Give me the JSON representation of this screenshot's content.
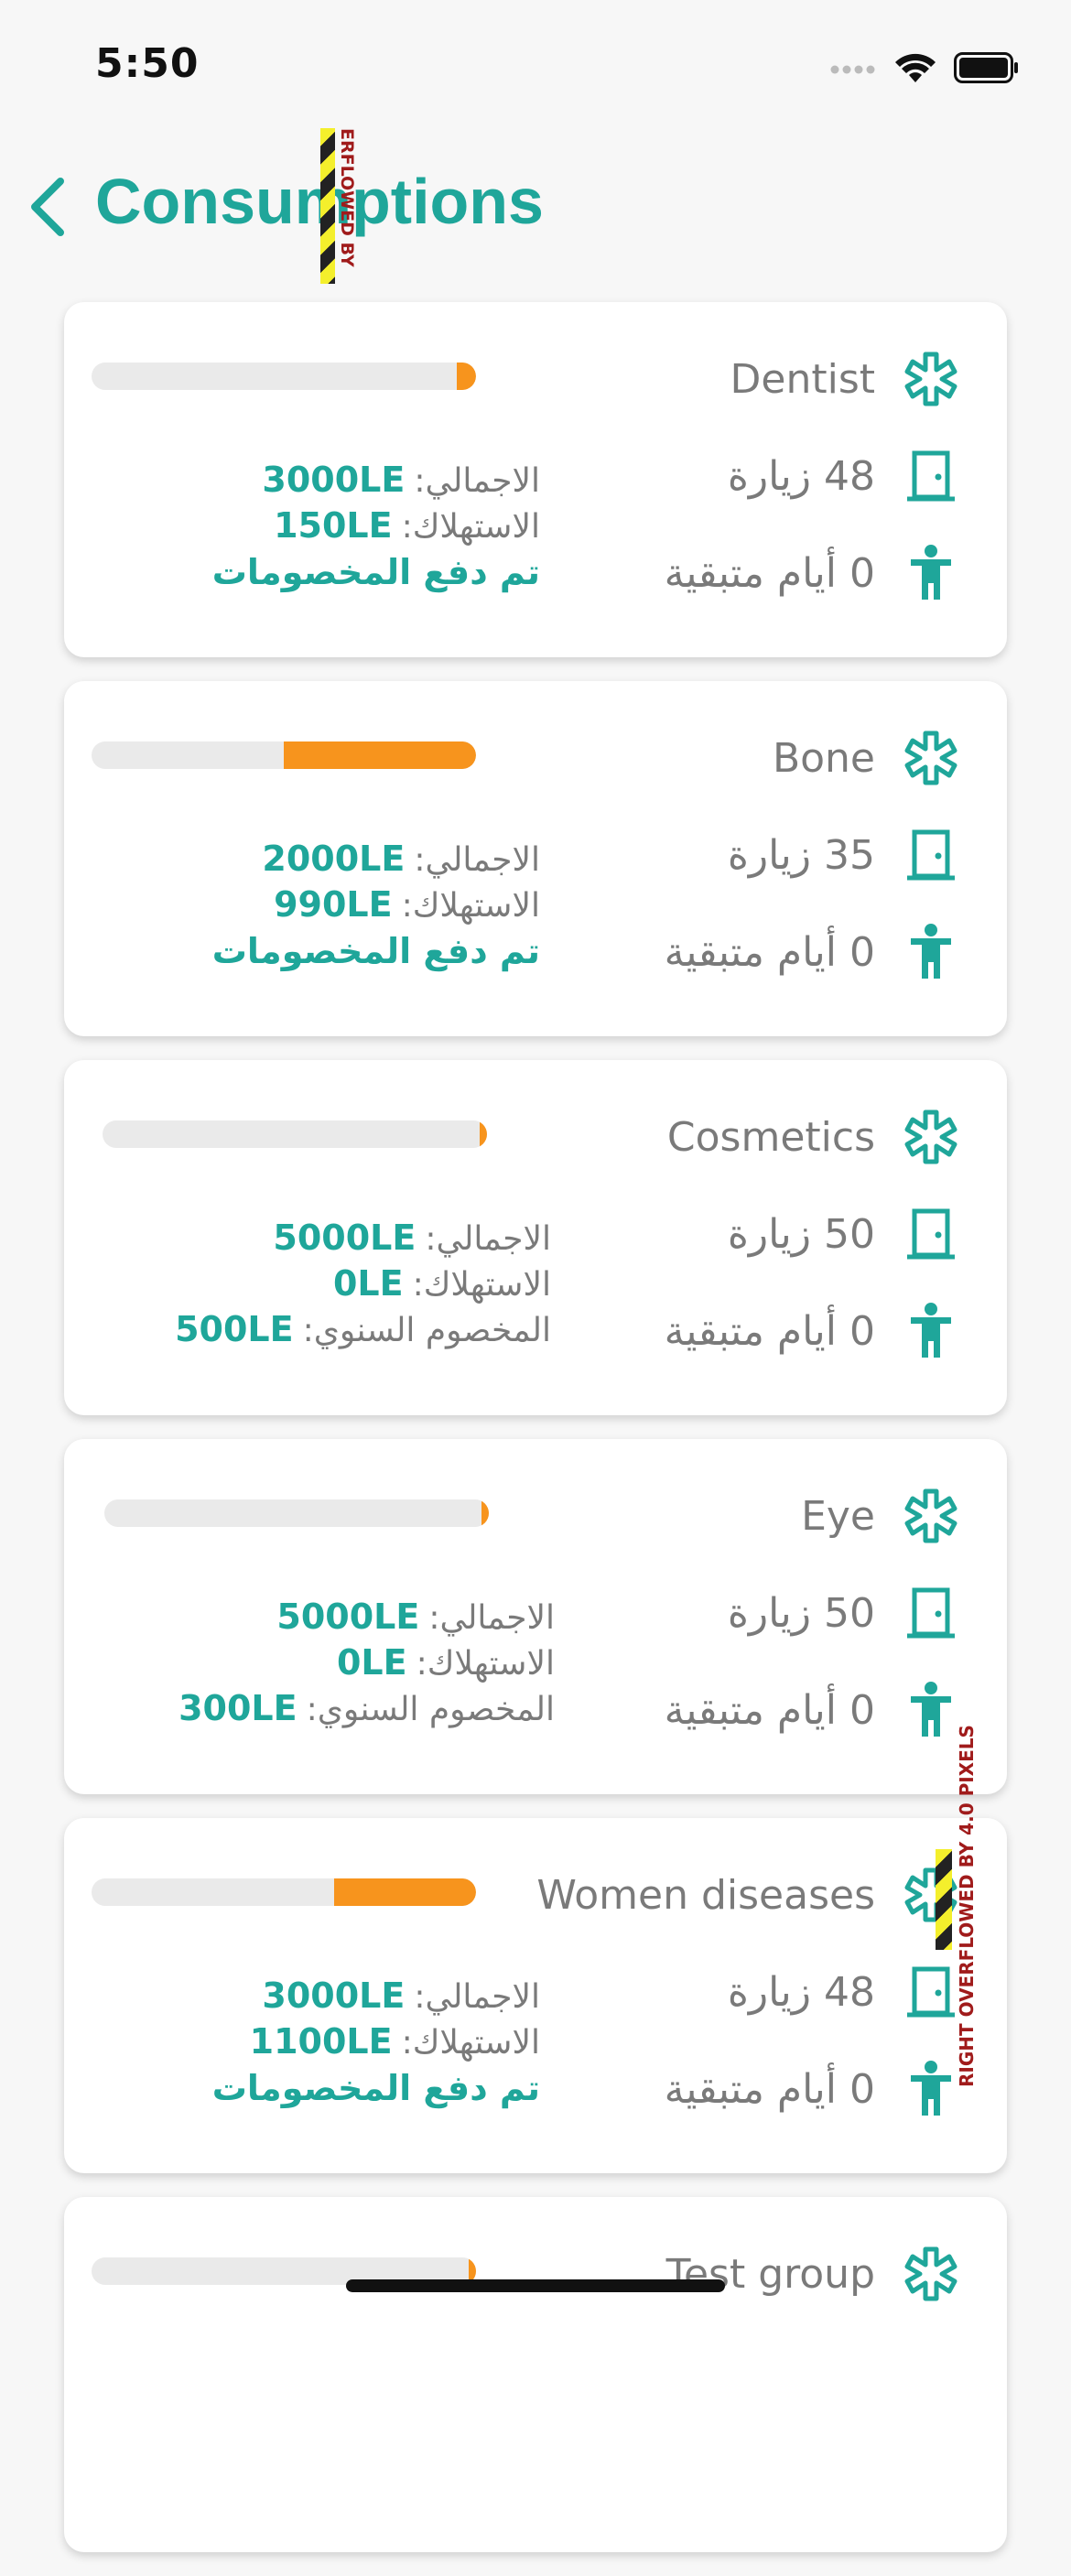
{
  "status_bar": {
    "time": "5:50"
  },
  "header": {
    "title": "Consumptions"
  },
  "debug": {
    "overflow_top_text": "ERFLOWED BY",
    "overflow_side_text": "RIGHT OVERFLOWED BY 4.0 PIXELS"
  },
  "colors": {
    "accent": "#1fa69a",
    "bar_fill": "#f7941d",
    "bar_track": "#eaeaea"
  },
  "icons": {
    "category": "asterisk-icon",
    "visits": "door-icon",
    "days": "person-icon",
    "back": "chevron-left-icon"
  },
  "cards": [
    {
      "name": "Dentist",
      "visits": "48 زيارة",
      "days": "0 أيام متبقية",
      "total_label": "الاجمالي:",
      "total_value": "3000LE",
      "consumption_label": "الاستهلاك:",
      "consumption_value": "150LE",
      "footer": "تم دفع المخصومات",
      "progress": 0.05
    },
    {
      "name": "Bone",
      "visits": "35 زيارة",
      "days": "0 أيام متبقية",
      "total_label": "الاجمالي:",
      "total_value": "2000LE",
      "consumption_label": "الاستهلاك:",
      "consumption_value": "990LE",
      "footer": "تم دفع المخصومات",
      "progress": 0.5
    },
    {
      "name": "Cosmetics",
      "visits": "50 زيارة",
      "days": "0 أيام متبقية",
      "total_label": "الاجمالي:",
      "total_value": "5000LE",
      "consumption_label": "الاستهلاك:",
      "consumption_value": "0LE",
      "deductible_label": "المخصوم السنوي:",
      "deductible_value": "500LE",
      "progress": 0.02
    },
    {
      "name": "Eye",
      "visits": "50 زيارة",
      "days": "0 أيام متبقية",
      "total_label": "الاجمالي:",
      "total_value": "5000LE",
      "consumption_label": "الاستهلاك:",
      "consumption_value": "0LE",
      "deductible_label": "المخصوم السنوي:",
      "deductible_value": "300LE",
      "progress": 0.02
    },
    {
      "name": "Women diseases",
      "visits": "48 زيارة",
      "days": "0 أيام متبقية",
      "total_label": "الاجمالي:",
      "total_value": "3000LE",
      "consumption_label": "الاستهلاك:",
      "consumption_value": "1100LE",
      "footer": "تم دفع المخصومات",
      "progress": 0.37
    },
    {
      "name": "Test group",
      "progress": 0.02
    }
  ]
}
